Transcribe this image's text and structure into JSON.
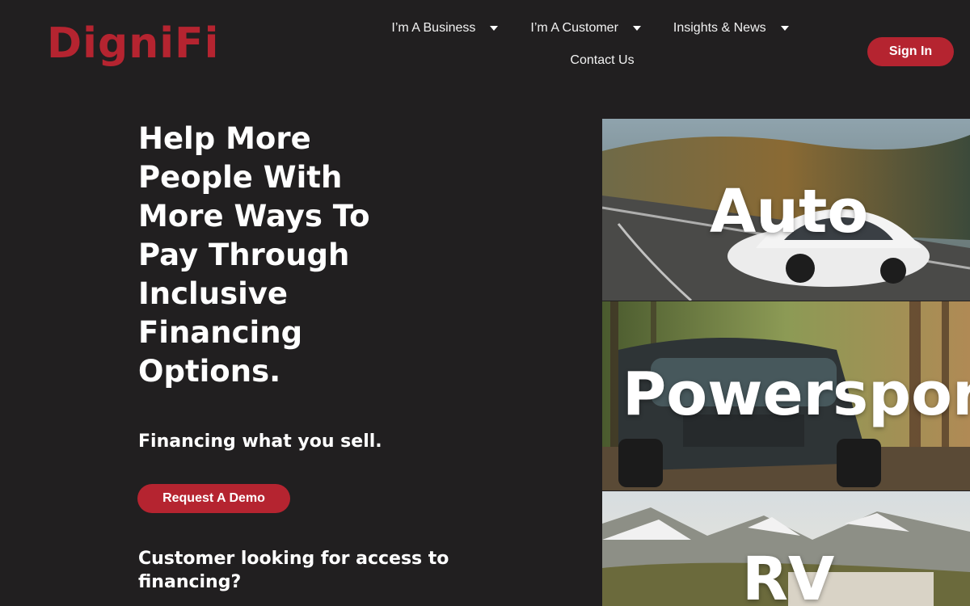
{
  "header": {
    "logo_text": "DigniFi",
    "nav": [
      {
        "label": "I’m A Business",
        "has_dropdown": true
      },
      {
        "label": "I’m A Customer",
        "has_dropdown": true
      },
      {
        "label": "Insights & News",
        "has_dropdown": true
      },
      {
        "label": "Contact Us",
        "has_dropdown": false
      }
    ],
    "sign_in_label": "Sign In"
  },
  "hero": {
    "title": "Help More People With More Ways To Pay Through Inclusive Financing Options.",
    "subtitle": "Financing what you sell.",
    "demo_button_label": "Request A Demo",
    "customer_question": "Customer looking for access to financing?"
  },
  "categories": [
    {
      "label": "Auto",
      "image": "car-on-road-photo"
    },
    {
      "label": "Powersports",
      "image": "atv-in-forest-photo"
    },
    {
      "label": "RV",
      "image": "rv-mountain-photo"
    }
  ],
  "colors": {
    "background": "#211f20",
    "accent": "#b52430",
    "text": "#ffffff"
  }
}
